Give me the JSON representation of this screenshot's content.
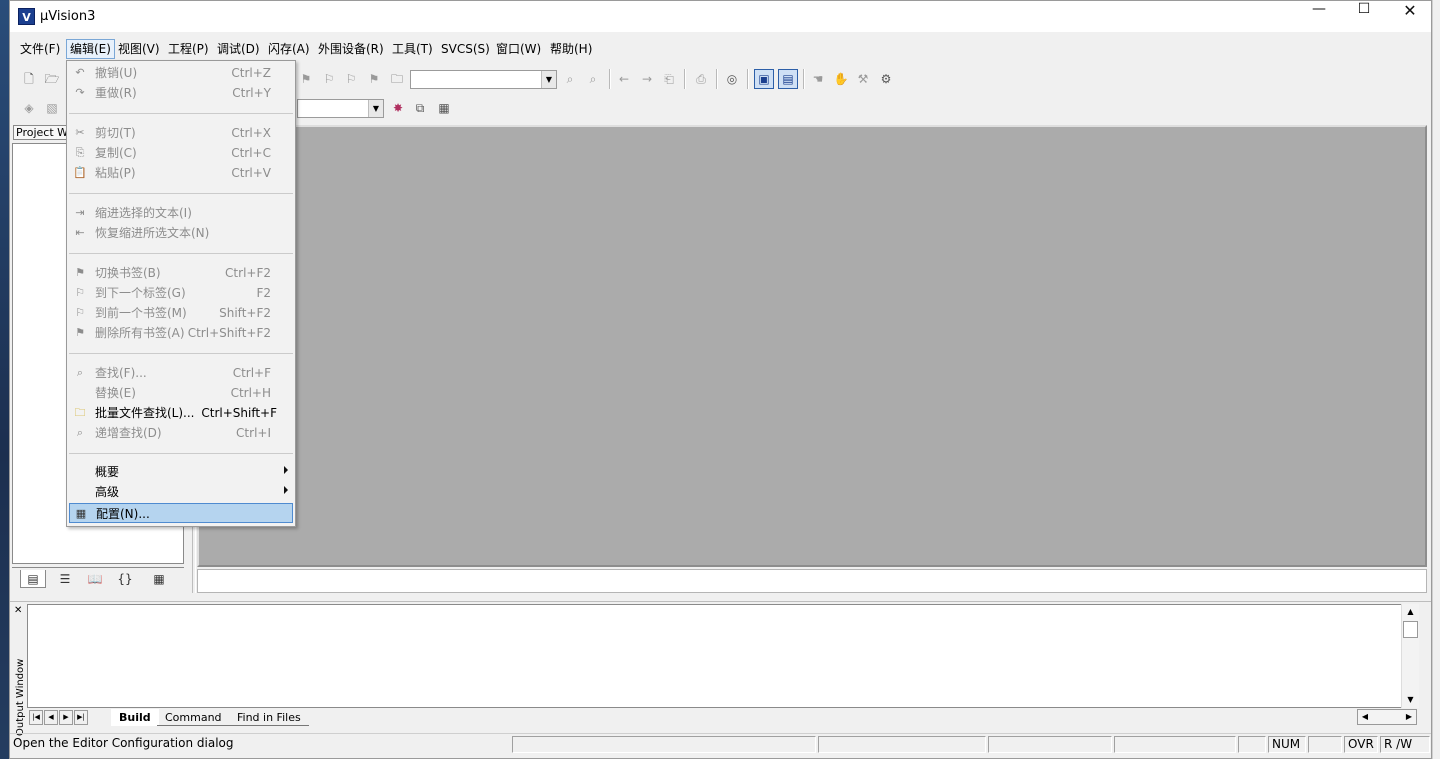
{
  "window": {
    "title": "µVision3",
    "icon_letter": "V",
    "controls": {
      "minimize": "—",
      "maximize": "☐",
      "close": "✕"
    }
  },
  "menubar": [
    {
      "label": "文件(F)"
    },
    {
      "label": "编辑(E)",
      "active": true
    },
    {
      "label": "视图(V)"
    },
    {
      "label": "工程(P)"
    },
    {
      "label": "调试(D)"
    },
    {
      "label": "闪存(A)"
    },
    {
      "label": "外围设备(R)"
    },
    {
      "label": "工具(T)"
    },
    {
      "label": "SVCS(S)"
    },
    {
      "label": "窗口(W)"
    },
    {
      "label": "帮助(H)"
    }
  ],
  "edit_menu": {
    "items": [
      {
        "icon": "undo-icon",
        "glyph": "↶",
        "label": "撤销(U)",
        "accel": "Ctrl+Z",
        "enabled": false
      },
      {
        "icon": "redo-icon",
        "glyph": "↷",
        "label": "重做(R)",
        "accel": "Ctrl+Y",
        "enabled": false
      },
      {
        "icon": "cut-icon",
        "glyph": "✂",
        "label": "剪切(T)",
        "accel": "Ctrl+X",
        "enabled": false
      },
      {
        "icon": "copy-icon",
        "glyph": "⎘",
        "label": "复制(C)",
        "accel": "Ctrl+C",
        "enabled": false
      },
      {
        "icon": "paste-icon",
        "glyph": "📋",
        "label": "粘贴(P)",
        "accel": "Ctrl+V",
        "enabled": false
      },
      {
        "icon": "indent-icon",
        "glyph": "⇥",
        "label": "缩进选择的文本(I)",
        "accel": "",
        "enabled": false
      },
      {
        "icon": "unindent-icon",
        "glyph": "⇤",
        "label": "恢复缩进所选文本(N)",
        "accel": "",
        "enabled": false
      },
      {
        "icon": "toggle-bookmark-icon",
        "glyph": "⚑",
        "label": "切换书签(B)",
        "accel": "Ctrl+F2",
        "enabled": false
      },
      {
        "icon": "next-bookmark-icon",
        "glyph": "⚐",
        "label": "到下一个标签(G)",
        "accel": "F2",
        "enabled": false
      },
      {
        "icon": "prev-bookmark-icon",
        "glyph": "⚐",
        "label": "到前一个书签(M)",
        "accel": "Shift+F2",
        "enabled": false
      },
      {
        "icon": "clear-bookmarks-icon",
        "glyph": "⚑",
        "label": "删除所有书签(A)",
        "accel": "Ctrl+Shift+F2",
        "enabled": false
      },
      {
        "icon": "find-icon",
        "glyph": "⌕",
        "label": "查找(F)...",
        "accel": "Ctrl+F",
        "enabled": false
      },
      {
        "icon": "replace-icon",
        "glyph": "",
        "label": "替换(E)",
        "accel": "Ctrl+H",
        "enabled": false
      },
      {
        "icon": "find-in-files-icon",
        "glyph": "🗀",
        "label": "批量文件查找(L)...",
        "accel": "Ctrl+Shift+F",
        "enabled": true
      },
      {
        "icon": "incremental-find-icon",
        "glyph": "⌕",
        "label": "递增查找(D)",
        "accel": "Ctrl+I",
        "enabled": false
      },
      {
        "icon": "",
        "glyph": "",
        "label": "概要",
        "accel": "",
        "enabled": true,
        "submenu": true
      },
      {
        "icon": "",
        "glyph": "",
        "label": "高级",
        "accel": "",
        "enabled": true,
        "submenu": true
      },
      {
        "icon": "configuration-icon",
        "glyph": "▦",
        "label": "配置(N)...",
        "accel": "",
        "enabled": true,
        "highlight": true
      }
    ]
  },
  "project_workspace": {
    "caption": "Project Wo",
    "tabs": [
      {
        "icon": "files-tab-icon",
        "glyph": "▤"
      },
      {
        "icon": "regs-tab-icon",
        "glyph": "☰"
      },
      {
        "icon": "books-tab-icon",
        "glyph": "📖"
      },
      {
        "icon": "functions-tab-icon",
        "glyph": "{}"
      },
      {
        "icon": "templates-tab-icon",
        "glyph": "▦"
      }
    ]
  },
  "output_window": {
    "caption": "Output Window",
    "tabs": [
      {
        "label": "Build",
        "selected": true
      },
      {
        "label": "Command",
        "selected": false
      },
      {
        "label": "Find in Files",
        "selected": false
      }
    ]
  },
  "statusbar": {
    "message": "Open the Editor Configuration dialog",
    "num": "NUM",
    "ovr": "OVR",
    "rw": "R /W"
  }
}
